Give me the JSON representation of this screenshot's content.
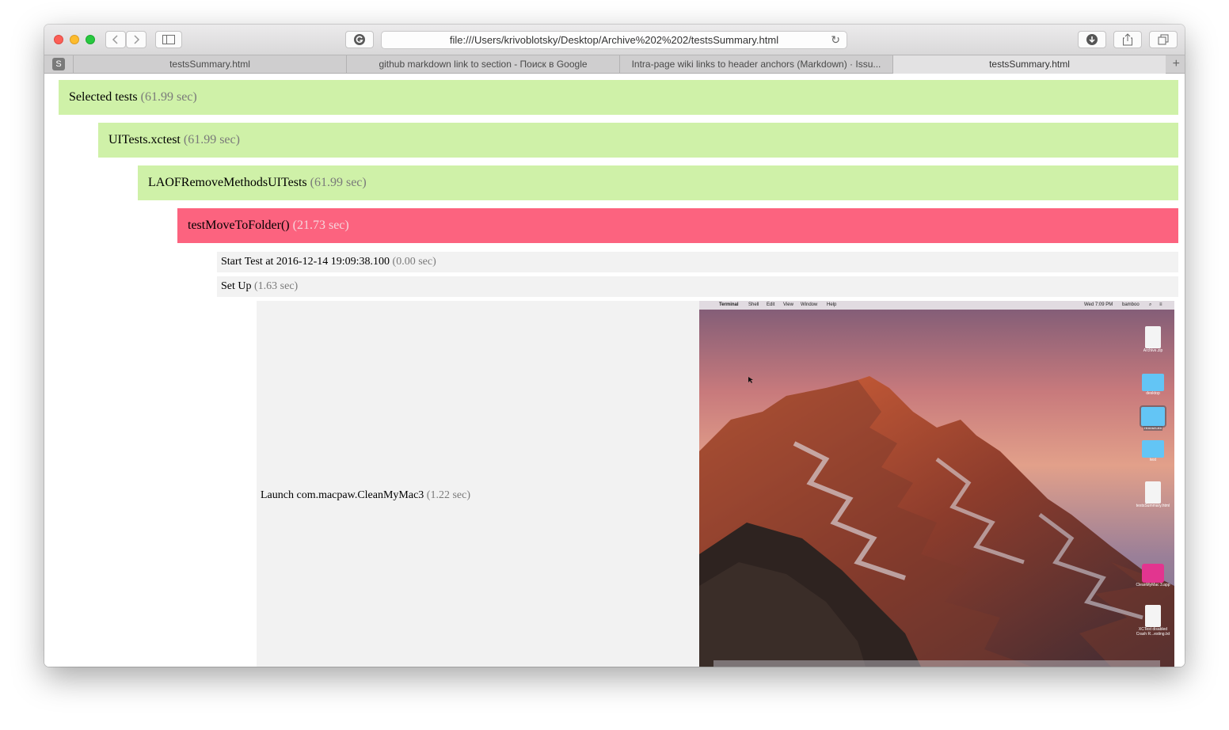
{
  "browser": {
    "url": "file:///Users/krivoblotsky/Desktop/Archive%202%202/testsSummary.html",
    "pinned_tab_letter": "S",
    "tabs": [
      {
        "label": "testsSummary.html"
      },
      {
        "label": "github markdown link to section - Поиск в Google"
      },
      {
        "label": "Intra-page wiki links to header anchors (Markdown) · Issu..."
      },
      {
        "label": "testsSummary.html"
      }
    ],
    "new_tab_symbol": "+"
  },
  "report": {
    "selected": {
      "name": "Selected tests",
      "time": "(61.99 sec)"
    },
    "bundle": {
      "name": "UITests.xctest",
      "time": "(61.99 sec)"
    },
    "suite": {
      "name": "LAOFRemoveMethodsUITests",
      "time": "(61.99 sec)"
    },
    "test": {
      "name": "testMoveToFolder()",
      "time": "(21.73 sec)"
    },
    "steps": [
      {
        "name": "Start Test at 2016-12-14 19:09:38.100",
        "time": "(0.00 sec)"
      },
      {
        "name": "Set Up",
        "time": "(1.63 sec)"
      },
      {
        "name": "Launch com.macpaw.CleanMyMac3",
        "time": "(1.22 sec)"
      }
    ]
  },
  "screenshot": {
    "menubar": {
      "app": "Terminal",
      "menus": [
        "Shell",
        "Edit",
        "View",
        "Window",
        "Help"
      ],
      "clock": "Wed 7:09 PM",
      "user": "bamboo"
    },
    "desktop_icons": [
      {
        "label": "Archive.zip"
      },
      {
        "label": "desktop"
      },
      {
        "label": "resources"
      },
      {
        "label": "test"
      },
      {
        "label": "testsSummary.html"
      },
      {
        "label": "CleanMyMac 3.app"
      },
      {
        "label": "XCTest disabled Crash R...esting.txt"
      }
    ]
  },
  "colors": {
    "passed": "#cff1a8",
    "failed": "#fc637f",
    "step": "#f2f2f2"
  }
}
